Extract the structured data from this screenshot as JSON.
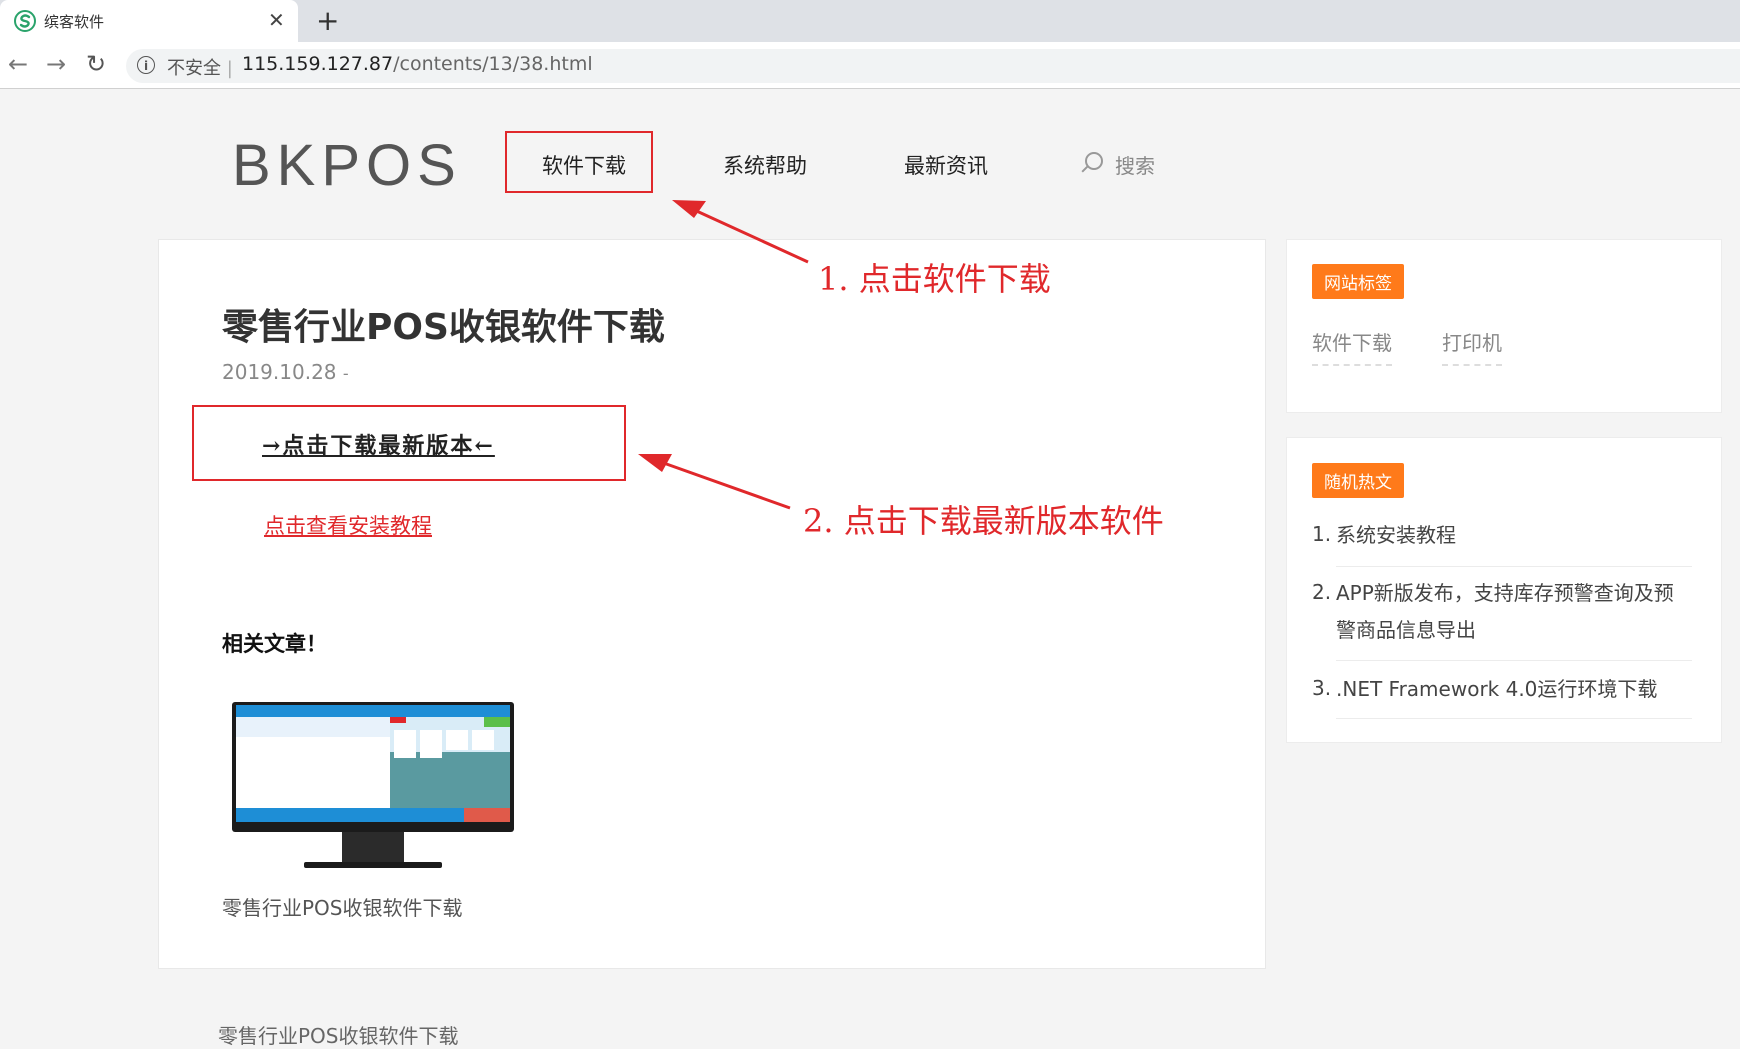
{
  "browser": {
    "tab_title": "缤客软件",
    "tab_close": "✕",
    "new_tab": "+",
    "back": "←",
    "forward": "→",
    "reload": "↻",
    "info_icon": "i",
    "insecure_label": "不安全",
    "separator": "|",
    "url_host": "115.159.127.87",
    "url_path": "/contents/13/38.html"
  },
  "header": {
    "logo": "BKPOS",
    "nav": [
      "软件下载",
      "系统帮助",
      "最新资讯"
    ],
    "search_label": "搜索"
  },
  "article": {
    "title": "零售行业POS收银软件下载",
    "date": "2019.10.28",
    "date_suffix": "-",
    "download_link": "→点击下载最新版本←",
    "tutorial_link": "点击查看安装教程",
    "related_title": "相关文章！",
    "related_caption": "零售行业POS收银软件下载",
    "below_text": "零售行业POS收银软件下载"
  },
  "sidebar": {
    "tags_badge": "网站标签",
    "tags": [
      "软件下载",
      "打印机"
    ],
    "hot_badge": "随机热文",
    "hot_items": [
      {
        "num": "1.",
        "text": "系统安装教程"
      },
      {
        "num": "2.",
        "text": "APP新版发布，支持库存预警查询及预警商品信息导出"
      },
      {
        "num": "3.",
        "text": ".NET Framework 4.0运行环境下载"
      }
    ]
  },
  "annotations": {
    "step1": "1. 点击软件下载",
    "step2": "2. 点击下载最新版本软件"
  },
  "colors": {
    "annotation_red": "#e0282b",
    "badge_orange": "#ff7a1a",
    "pos_blue": "#1e8ed6",
    "pos_teal": "#5a9aa0"
  }
}
